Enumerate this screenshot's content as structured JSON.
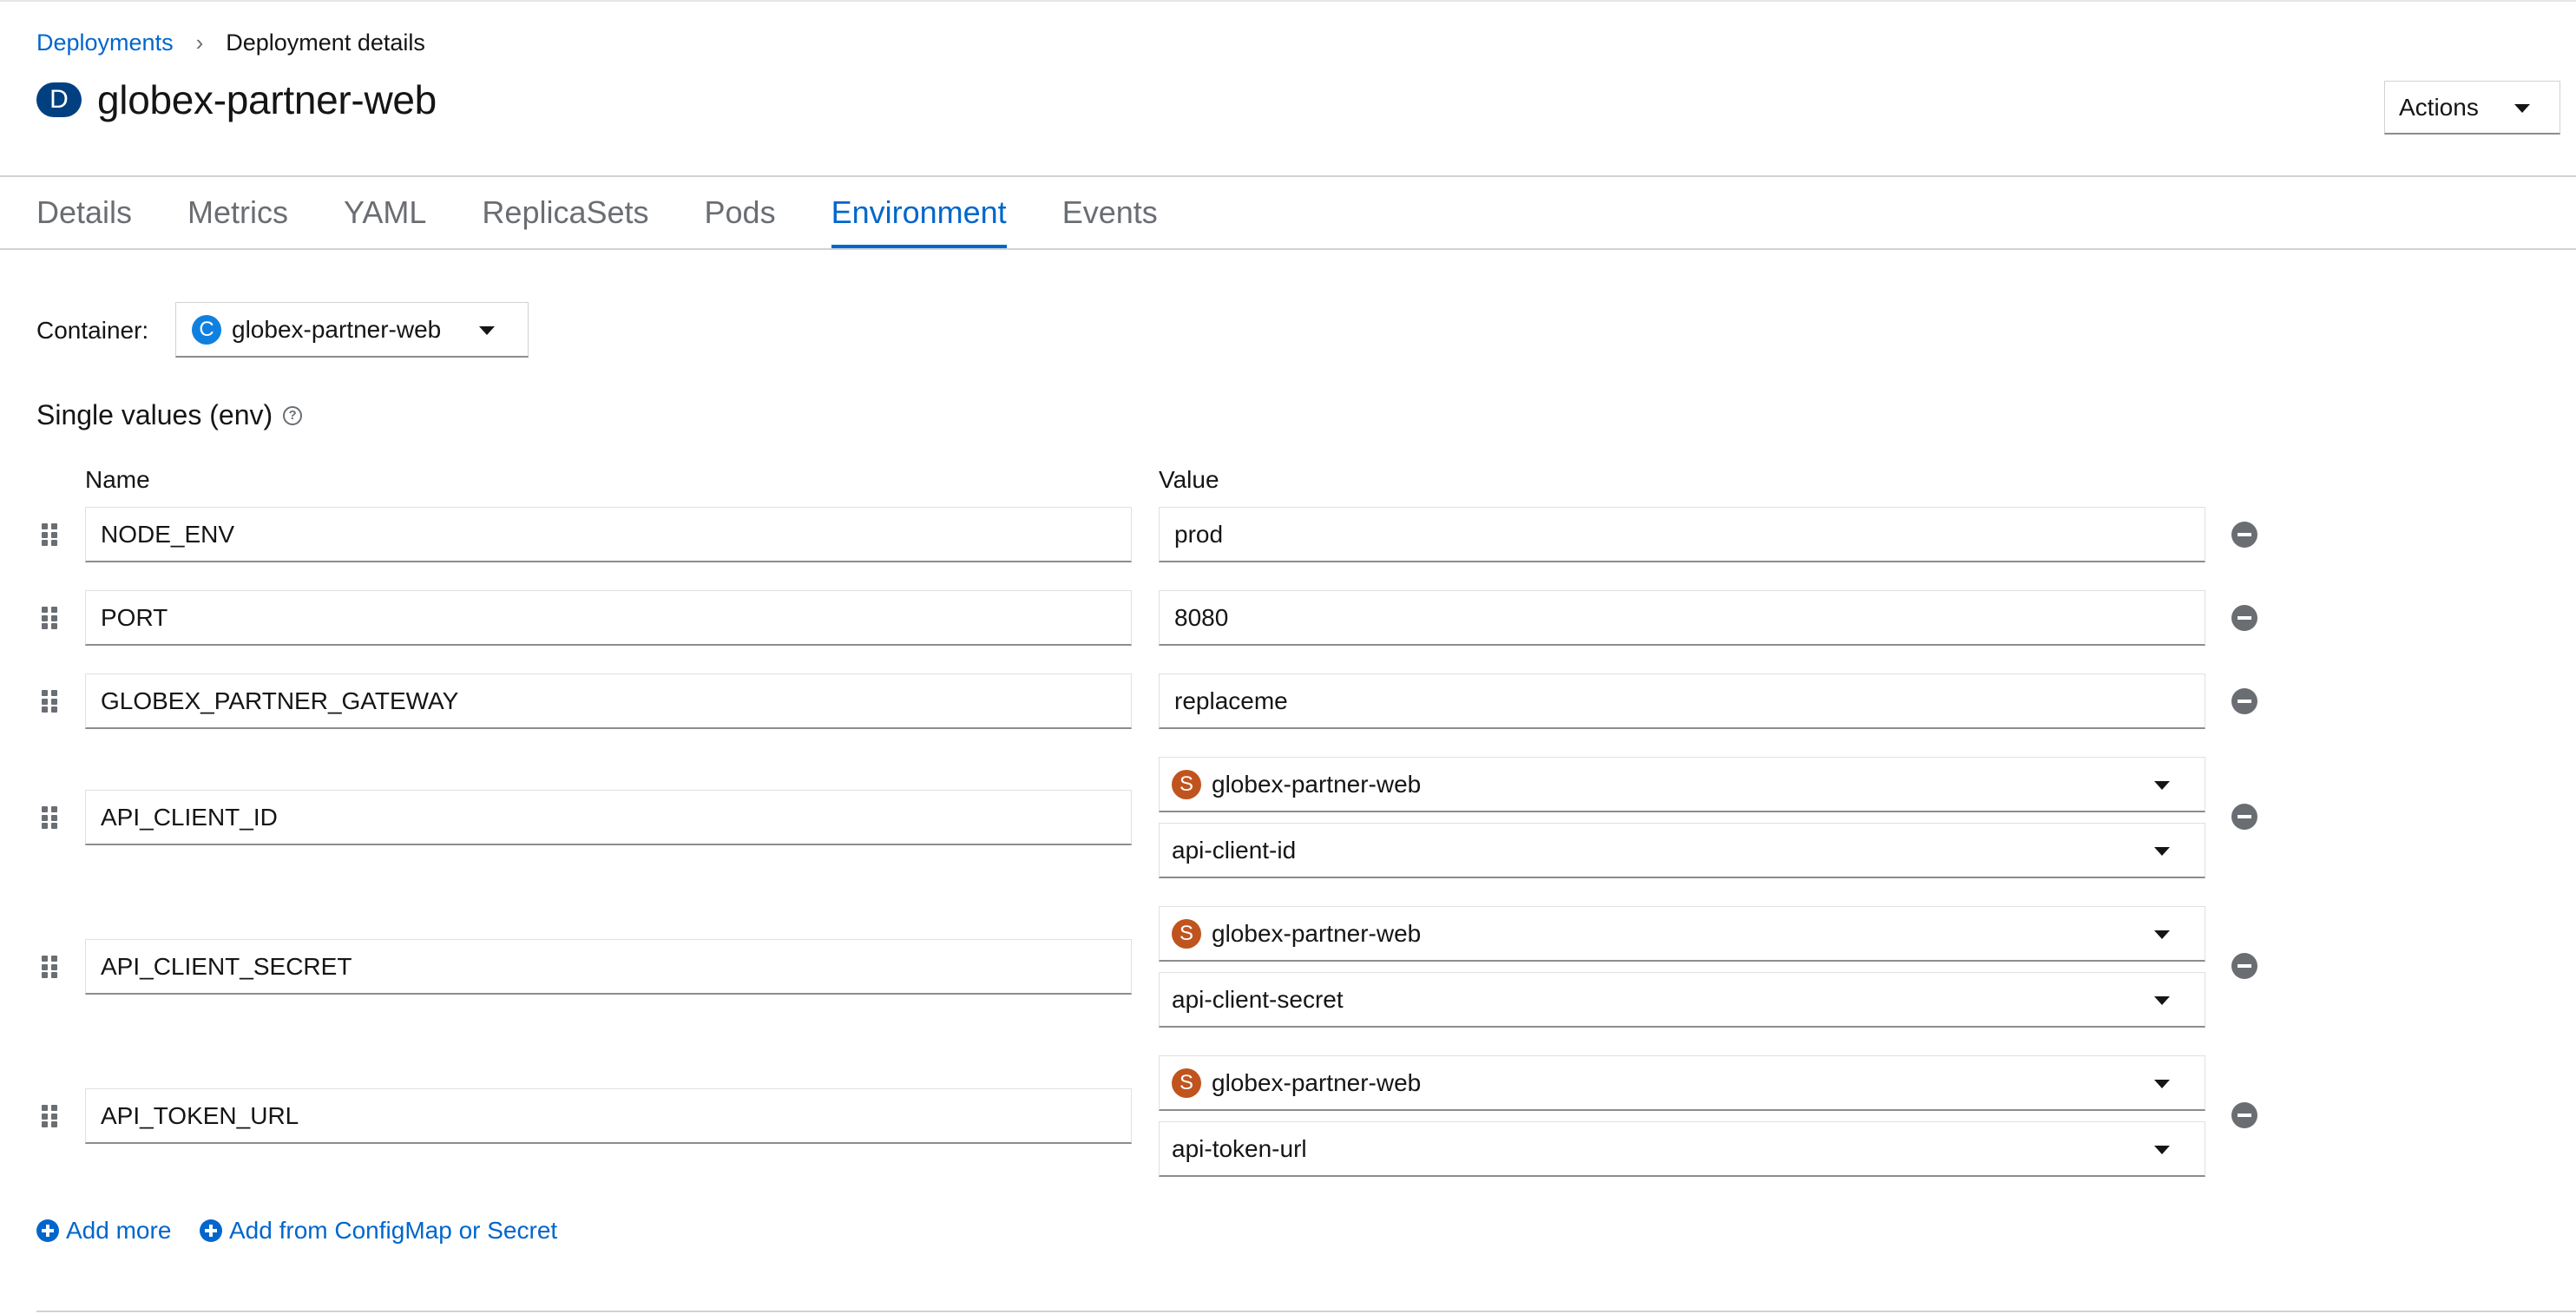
{
  "breadcrumb": {
    "parent": "Deployments",
    "separator": "›",
    "current": "Deployment details"
  },
  "header": {
    "kind_badge": "D",
    "title": "globex-partner-web",
    "actions_label": "Actions"
  },
  "tabs": [
    {
      "label": "Details",
      "active": false
    },
    {
      "label": "Metrics",
      "active": false
    },
    {
      "label": "YAML",
      "active": false
    },
    {
      "label": "ReplicaSets",
      "active": false
    },
    {
      "label": "Pods",
      "active": false
    },
    {
      "label": "Environment",
      "active": true
    },
    {
      "label": "Events",
      "active": false
    }
  ],
  "container": {
    "label": "Container:",
    "badge": "C",
    "value": "globex-partner-web"
  },
  "section": {
    "title": "Single values (env)",
    "help_glyph": "?"
  },
  "columns": {
    "name": "Name",
    "value": "Value"
  },
  "env": [
    {
      "name": "NODE_ENV",
      "value": "prod"
    },
    {
      "name": "PORT",
      "value": "8080"
    },
    {
      "name": "GLOBEX_PARTNER_GATEWAY",
      "value": "replaceme"
    },
    {
      "name": "API_CLIENT_ID",
      "secret_badge": "S",
      "secret": "globex-partner-web",
      "key": "api-client-id"
    },
    {
      "name": "API_CLIENT_SECRET",
      "secret_badge": "S",
      "secret": "globex-partner-web",
      "key": "api-client-secret"
    },
    {
      "name": "API_TOKEN_URL",
      "secret_badge": "S",
      "secret": "globex-partner-web",
      "key": "api-token-url"
    }
  ],
  "links": {
    "add_more": "Add more",
    "add_from": "Add from ConfigMap or Secret"
  },
  "colors": {
    "link": "#0066cc",
    "deployment_badge": "#004080",
    "container_badge": "#0f80e0",
    "secret_badge": "#c0541f"
  },
  "icons": {
    "drag": "grip-vertical-icon",
    "remove": "minus-circle-icon",
    "add": "plus-circle-icon"
  }
}
